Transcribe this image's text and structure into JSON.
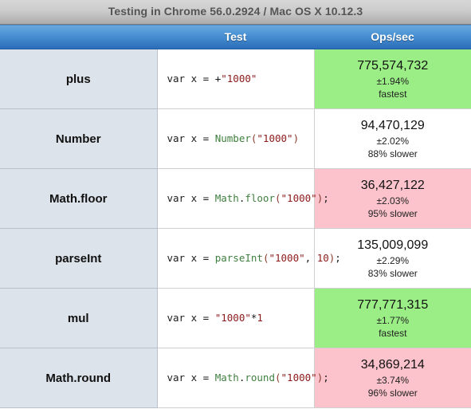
{
  "title": "Testing in Chrome 56.0.2924 / Mac OS X 10.12.3",
  "columns": {
    "name": "",
    "test": "Test",
    "ops": "Ops/sec"
  },
  "rows": [
    {
      "name": "plus",
      "code_plain": "var x = +\"1000\"",
      "code_tokens": [
        {
          "t": "var x = ",
          "c": "kw"
        },
        {
          "t": "+",
          "c": "op"
        },
        {
          "t": "\"1000\"",
          "c": "str"
        }
      ],
      "ops": "775,574,732",
      "margin": "±1.94%",
      "rank": "fastest",
      "status": "fastest"
    },
    {
      "name": "Number",
      "code_plain": "var x = Number(\"1000\")",
      "code_tokens": [
        {
          "t": "var x = ",
          "c": "kw"
        },
        {
          "t": "Number",
          "c": "fn"
        },
        {
          "t": "(",
          "c": "punc"
        },
        {
          "t": "\"1000\"",
          "c": "str"
        },
        {
          "t": ")",
          "c": "punc"
        }
      ],
      "ops": "94,470,129",
      "margin": "±2.02%",
      "rank": "88% slower",
      "status": "neutral"
    },
    {
      "name": "Math.floor",
      "code_plain": "var x = Math.floor(\"1000\");",
      "code_tokens": [
        {
          "t": "var x = ",
          "c": "kw"
        },
        {
          "t": "Math",
          "c": "fn"
        },
        {
          "t": ".",
          "c": "op"
        },
        {
          "t": "floor",
          "c": "fn"
        },
        {
          "t": "(",
          "c": "punc"
        },
        {
          "t": "\"1000\"",
          "c": "str"
        },
        {
          "t": ")",
          "c": "punc"
        },
        {
          "t": ";",
          "c": "op"
        }
      ],
      "ops": "36,427,122",
      "margin": "±2.03%",
      "rank": "95% slower",
      "status": "slowest"
    },
    {
      "name": "parseInt",
      "code_plain": "var x = parseInt(\"1000\", 10);",
      "code_tokens": [
        {
          "t": "var x = ",
          "c": "kw"
        },
        {
          "t": "parseInt",
          "c": "fn"
        },
        {
          "t": "(",
          "c": "punc"
        },
        {
          "t": "\"1000\"",
          "c": "str"
        },
        {
          "t": ", ",
          "c": "op"
        },
        {
          "t": "10",
          "c": "num"
        },
        {
          "t": ")",
          "c": "punc"
        },
        {
          "t": ";",
          "c": "op"
        }
      ],
      "ops": "135,009,099",
      "margin": "±2.29%",
      "rank": "83% slower",
      "status": "neutral"
    },
    {
      "name": "mul",
      "code_plain": "var x = \"1000\"*1",
      "code_tokens": [
        {
          "t": "var x = ",
          "c": "kw"
        },
        {
          "t": "\"1000\"",
          "c": "str"
        },
        {
          "t": "*",
          "c": "op"
        },
        {
          "t": "1",
          "c": "num"
        }
      ],
      "ops": "777,771,315",
      "margin": "±1.77%",
      "rank": "fastest",
      "status": "fastest"
    },
    {
      "name": "Math.round",
      "code_plain": "var x = Math.round(\"1000\");",
      "code_tokens": [
        {
          "t": "var x = ",
          "c": "kw"
        },
        {
          "t": "Math",
          "c": "fn"
        },
        {
          "t": ".",
          "c": "op"
        },
        {
          "t": "round",
          "c": "fn"
        },
        {
          "t": "(",
          "c": "punc"
        },
        {
          "t": "\"1000\"",
          "c": "str"
        },
        {
          "t": ")",
          "c": "punc"
        },
        {
          "t": ";",
          "c": "op"
        }
      ],
      "ops": "34,869,214",
      "margin": "±3.74%",
      "rank": "96% slower",
      "status": "slowest"
    }
  ],
  "colors": {
    "fastest_bg": "#9aee85",
    "slowest_bg": "#fcc3cc",
    "header_blue": "#2a6cb8",
    "name_col_bg": "#dde3ea",
    "string_red": "#8b1a1a",
    "function_green": "#3f7f3f"
  }
}
